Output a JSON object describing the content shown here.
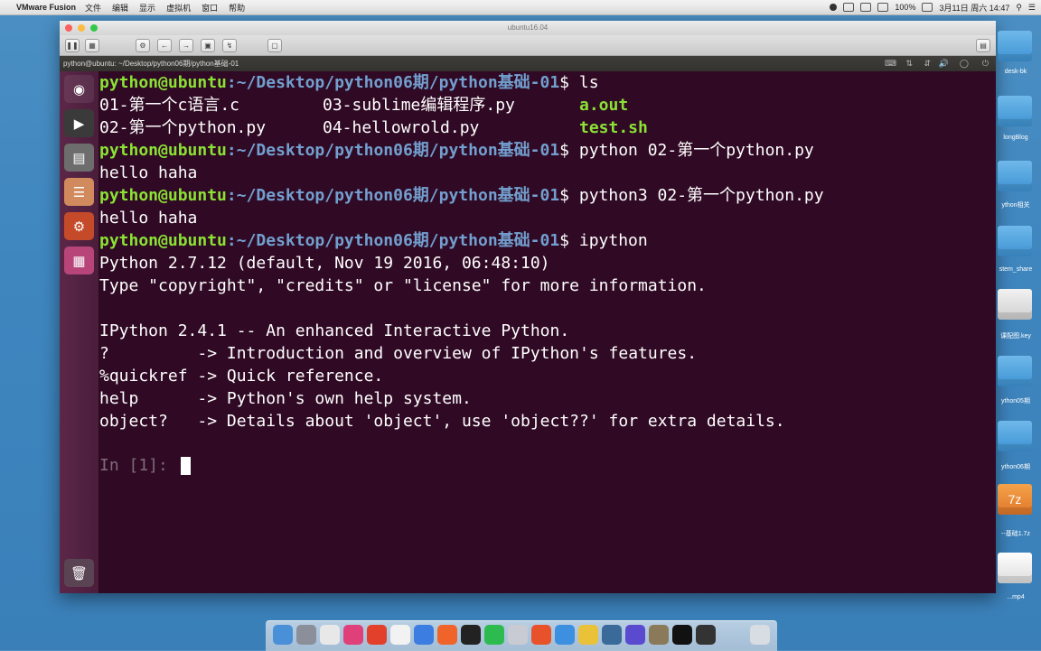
{
  "menubar": {
    "app_name": "VMware Fusion",
    "items": [
      "文件",
      "编辑",
      "显示",
      "虚拟机",
      "窗口",
      "帮助"
    ],
    "battery": "100%",
    "clock": "3月11日 周六 14:47"
  },
  "vm_window": {
    "title": "ubuntu16.04"
  },
  "ubuntu_window": {
    "title": "python@ubuntu: ~/Desktop/python06期/python基础-01"
  },
  "terminal": {
    "prompt_user": "python@ubuntu",
    "prompt_path": ":~/Desktop/python06期/python基础-01",
    "prompt_symbol": "$",
    "cmd_ls": " ls",
    "ls_row1_col1": "01-第一个c语言.c",
    "ls_row1_col2": "03-sublime编辑程序.py",
    "ls_row1_col3": "a.out",
    "ls_row2_col1": "02-第一个python.py",
    "ls_row2_col2": "04-hellowrold.py",
    "ls_row2_col3": "test.sh",
    "cmd_python": " python 02-第一个python.py",
    "out_hello1": "hello haha",
    "cmd_python3": " python3 02-第一个python.py",
    "out_hello2": "hello haha",
    "cmd_ipython": " ipython",
    "py_version": "Python 2.7.12 (default, Nov 19 2016, 06:48:10)",
    "py_type": "Type \"copyright\", \"credits\" or \"license\" for more information.",
    "ipy_banner": "IPython 2.4.1 -- An enhanced Interactive Python.",
    "ipy_help1": "?         -> Introduction and overview of IPython's features.",
    "ipy_help2": "%quickref -> Quick reference.",
    "ipy_help3": "help      -> Python's own help system.",
    "ipy_help4": "object?   -> Details about 'object', use 'object??' for extra details.",
    "in_prompt": "In [1]: "
  },
  "desktop_icons": [
    {
      "label": "desk-bk"
    },
    {
      "label": "longBlog"
    },
    {
      "label": "ython相关"
    },
    {
      "label": "stem_share"
    },
    {
      "label": "课配图.key"
    },
    {
      "label": "ython05期"
    },
    {
      "label": "ython06期"
    },
    {
      "label": "7z"
    },
    {
      "label": "--基础1.7z"
    },
    {
      "label": "...mp4"
    }
  ],
  "colors": {
    "terminal_bg": "#300a24",
    "prompt_green": "#8ae234",
    "prompt_blue": "#729fcf",
    "desktop_blue": "#3f86bf"
  }
}
